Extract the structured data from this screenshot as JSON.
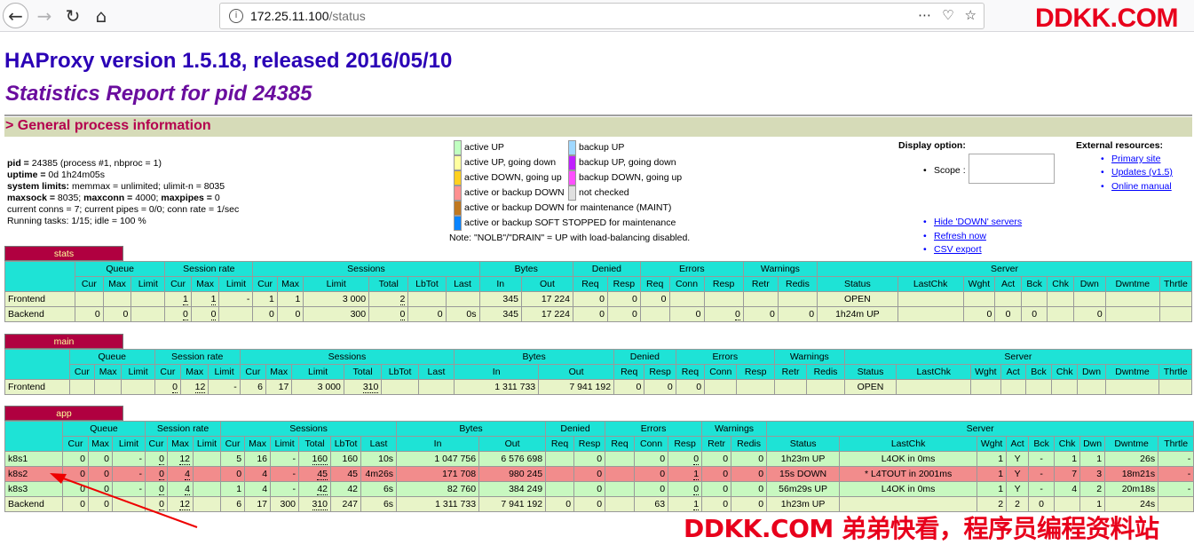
{
  "browser": {
    "url_host": "172.25.11.100",
    "url_path": "/status"
  },
  "watermark_top": "DDKK.COM",
  "watermark_bottom": "DDKK.COM 弟弟快看，程序员编程资料站",
  "title": "HAProxy version 1.5.18, released 2016/05/10",
  "subtitle": "Statistics Report for pid 24385",
  "general_header": "> General process information",
  "procinfo": [
    {
      "b": "pid = ",
      "t": "24385 (process #1, nbproc = 1)"
    },
    {
      "b": "uptime = ",
      "t": "0d 1h24m05s"
    },
    {
      "b": "system limits: ",
      "t": "memmax = unlimited; ulimit-n = 8035"
    },
    {
      "b": "maxsock = ",
      "t": "8035; ",
      "b2": "maxconn = ",
      "t2": "4000; ",
      "b3": "maxpipes = ",
      "t3": "0"
    },
    {
      "b": "",
      "t": "current conns = 7; current pipes = 0/0; conn rate = 1/sec"
    },
    {
      "b": "",
      "t": "Running tasks: 1/15; idle = 100 %"
    }
  ],
  "legend": {
    "left": [
      {
        "label": "active UP",
        "color": "#c0ffc0"
      },
      {
        "label": "active UP, going down",
        "color": "#ffffa0"
      },
      {
        "label": "active DOWN, going up",
        "color": "#ffd020"
      },
      {
        "label": "active or backup DOWN",
        "color": "#ff9090"
      },
      {
        "label": "active or backup DOWN for maintenance (MAINT)",
        "color": "#c07820"
      },
      {
        "label": "active or backup SOFT STOPPED for maintenance",
        "color": "#0a84ff"
      }
    ],
    "right": [
      {
        "label": "backup UP",
        "color": "#a0d8ff"
      },
      {
        "label": "backup UP, going down",
        "color": "#c020ff"
      },
      {
        "label": "backup DOWN, going up",
        "color": "#ff50ff"
      },
      {
        "label": "not checked",
        "color": "#e0e0e0"
      }
    ],
    "note": "Note: \"NOLB\"/\"DRAIN\" = UP with load-balancing disabled."
  },
  "display_option": {
    "title": "Display option:",
    "scope_label": "Scope :",
    "links": [
      "Hide 'DOWN' servers",
      "Refresh now",
      "CSV export"
    ]
  },
  "external": {
    "title": "External resources:",
    "links": [
      "Primary site",
      "Updates (v1.5)",
      "Online manual"
    ]
  },
  "proxies": {
    "stats": {
      "name": "stats",
      "rows": [
        {
          "cls": "fe",
          "c": [
            "Frontend",
            "",
            "",
            "",
            "1",
            "1",
            "-",
            "1",
            "1",
            "3 000",
            "2",
            "",
            "",
            "345",
            "17 224",
            "0",
            "0",
            "0",
            "",
            "",
            "",
            "",
            "OPEN",
            "",
            "",
            "",
            "",
            "",
            "",
            "",
            ""
          ]
        },
        {
          "cls": "be",
          "c": [
            "Backend",
            "0",
            "0",
            "",
            "0",
            "0",
            "",
            "0",
            "0",
            "300",
            "0",
            "0",
            "0s",
            "345",
            "17 224",
            "0",
            "0",
            "",
            "0",
            "0",
            "0",
            "0",
            "1h24m UP",
            "",
            "0",
            "0",
            "0",
            "",
            "0",
            "",
            ""
          ]
        }
      ]
    },
    "main": {
      "name": "main",
      "rows": [
        {
          "cls": "fe",
          "c": [
            "Frontend",
            "",
            "",
            "",
            "0",
            "12",
            "-",
            "6",
            "17",
            "3 000",
            "310",
            "",
            "",
            "1 311 733",
            "7 941 192",
            "0",
            "0",
            "0",
            "",
            "",
            "",
            "",
            "OPEN",
            "",
            "",
            "",
            "",
            "",
            "",
            "",
            ""
          ]
        }
      ]
    },
    "app": {
      "name": "app",
      "rows": [
        {
          "cls": "up",
          "c": [
            "k8s1",
            "0",
            "0",
            "-",
            "0",
            "12",
            "",
            "5",
            "16",
            "-",
            "160",
            "160",
            "10s",
            "1 047 756",
            "6 576 698",
            "",
            "0",
            "",
            "0",
            "0",
            "0",
            "0",
            "1h23m UP",
            "L4OK in 0ms",
            "1",
            "Y",
            "-",
            "1",
            "1",
            "26s",
            "-"
          ]
        },
        {
          "cls": "down",
          "c": [
            "k8s2",
            "0",
            "0",
            "-",
            "0",
            "4",
            "",
            "0",
            "4",
            "-",
            "45",
            "45",
            "4m26s",
            "171 708",
            "980 245",
            "",
            "0",
            "",
            "0",
            "1",
            "0",
            "0",
            "15s DOWN",
            "* L4TOUT in 2001ms",
            "1",
            "Y",
            "-",
            "7",
            "3",
            "18m21s",
            "-"
          ]
        },
        {
          "cls": "up",
          "c": [
            "k8s3",
            "0",
            "0",
            "-",
            "0",
            "4",
            "",
            "1",
            "4",
            "-",
            "42",
            "42",
            "6s",
            "82 760",
            "384 249",
            "",
            "0",
            "",
            "0",
            "0",
            "0",
            "0",
            "56m29s UP",
            "L4OK in 0ms",
            "1",
            "Y",
            "-",
            "4",
            "2",
            "20m18s",
            "-"
          ]
        },
        {
          "cls": "be",
          "c": [
            "Backend",
            "0",
            "0",
            "",
            "0",
            "12",
            "",
            "6",
            "17",
            "300",
            "310",
            "247",
            "6s",
            "1 311 733",
            "7 941 192",
            "0",
            "0",
            "",
            "63",
            "1",
            "0",
            "0",
            "1h23m UP",
            "",
            "2",
            "2",
            "0",
            "",
            "1",
            "24s",
            ""
          ]
        }
      ]
    }
  },
  "headers": {
    "groups": [
      "Queue",
      "Session rate",
      "Sessions",
      "Bytes",
      "Denied",
      "Errors",
      "Warnings",
      "Server"
    ],
    "cols": [
      "Cur",
      "Max",
      "Limit",
      "Cur",
      "Max",
      "Limit",
      "Cur",
      "Max",
      "Limit",
      "Total",
      "LbTot",
      "Last",
      "In",
      "Out",
      "Req",
      "Resp",
      "Req",
      "Conn",
      "Resp",
      "Retr",
      "Redis",
      "Status",
      "LastChk",
      "Wght",
      "Act",
      "Bck",
      "Chk",
      "Dwn",
      "Dwntme",
      "Thrtle"
    ]
  }
}
